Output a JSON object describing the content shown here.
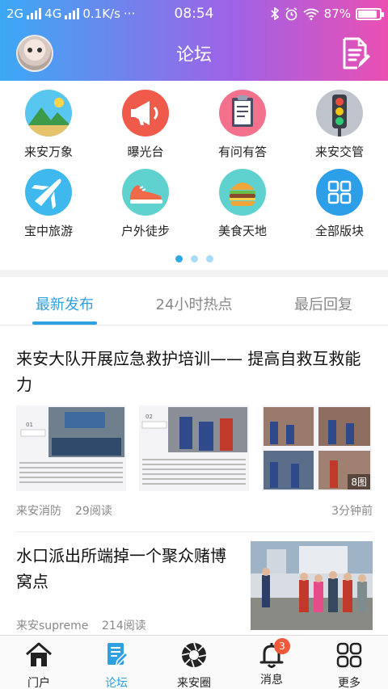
{
  "status_bar": {
    "network_1": "2G",
    "network_2": "4G",
    "speed": "0.1K/s",
    "more": "···",
    "time": "08:54",
    "battery_text": "87%",
    "battery_level": 0.87
  },
  "header": {
    "title": "论坛"
  },
  "categories": [
    {
      "label": "来安万象",
      "icon": "landscape-icon"
    },
    {
      "label": "曝光台",
      "icon": "megaphone-icon"
    },
    {
      "label": "有问有答",
      "icon": "clipboard-icon"
    },
    {
      "label": "来安交管",
      "icon": "traffic-light-icon"
    },
    {
      "label": "宝中旅游",
      "icon": "airplane-icon"
    },
    {
      "label": "户外徒步",
      "icon": "sneaker-icon"
    },
    {
      "label": "美食天地",
      "icon": "burger-icon"
    },
    {
      "label": "全部版块",
      "icon": "grid-icon"
    }
  ],
  "pager": {
    "count": 3,
    "active": 0
  },
  "tabs": [
    {
      "label": "最新发布",
      "active": true
    },
    {
      "label": "24小时热点",
      "active": false
    },
    {
      "label": "最后回复",
      "active": false
    }
  ],
  "posts": [
    {
      "title": "来安大队开展应急救护培训—— 提高自救互救能力",
      "author": "来安消防",
      "reads": "29阅读",
      "time": "3分钟前",
      "photo_count": "8图"
    },
    {
      "title": "水口派出所端掉一个聚众赌博窝点",
      "author": "来安supreme",
      "reads": "214阅读"
    }
  ],
  "bottom_nav": [
    {
      "label": "门户",
      "icon": "home-icon",
      "active": false
    },
    {
      "label": "论坛",
      "icon": "forum-icon",
      "active": true
    },
    {
      "label": "来安圈",
      "icon": "aperture-icon",
      "active": false
    },
    {
      "label": "消息",
      "icon": "bell-icon",
      "active": false,
      "badge": "3"
    },
    {
      "label": "更多",
      "icon": "more-grid-icon",
      "active": false
    }
  ],
  "colors": {
    "accent": "#2fa0e0",
    "badge": "#f05a3b",
    "gradient_start": "#3ba9f5",
    "gradient_end": "#ea4fb2"
  }
}
